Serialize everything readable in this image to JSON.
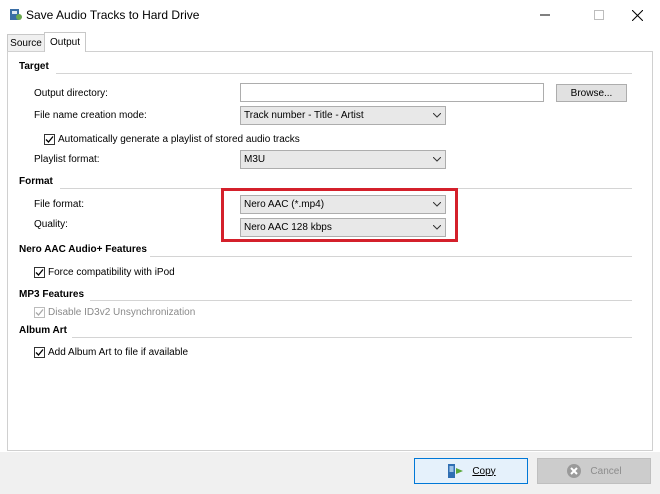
{
  "window": {
    "title": "Save Audio Tracks to Hard Drive",
    "icon": "save-audio-icon"
  },
  "tabs": [
    {
      "label": "Source",
      "active": false
    },
    {
      "label": "Output",
      "active": true
    }
  ],
  "target": {
    "header": "Target",
    "output_directory": {
      "label": "Output directory:",
      "value": "",
      "browse_label": "Browse..."
    },
    "file_name_mode": {
      "label": "File name creation mode:",
      "value": "Track number - Title - Artist"
    },
    "auto_playlist": {
      "label": "Automatically generate a playlist of stored audio tracks",
      "checked": true
    },
    "playlist_format": {
      "label": "Playlist format:",
      "value": "M3U"
    }
  },
  "format": {
    "header": "Format",
    "file_format": {
      "label": "File format:",
      "value": "Nero AAC (*.mp4)"
    },
    "quality": {
      "label": "Quality:",
      "value": "Nero AAC 128 kbps"
    }
  },
  "nero_features": {
    "header": "Nero AAC Audio+ Features",
    "force_ipod": {
      "label": "Force compatibility with iPod",
      "checked": true
    }
  },
  "mp3_features": {
    "header": "MP3 Features",
    "disable_id3": {
      "label": "Disable ID3v2 Unsynchronization",
      "checked": true,
      "enabled": false
    }
  },
  "album_art": {
    "header": "Album Art",
    "add_album_art": {
      "label": "Add Album Art to file if available",
      "checked": true
    }
  },
  "footer": {
    "copy_label": "Copy",
    "cancel_label": "Cancel"
  },
  "colors": {
    "highlight": "#d4202b"
  }
}
